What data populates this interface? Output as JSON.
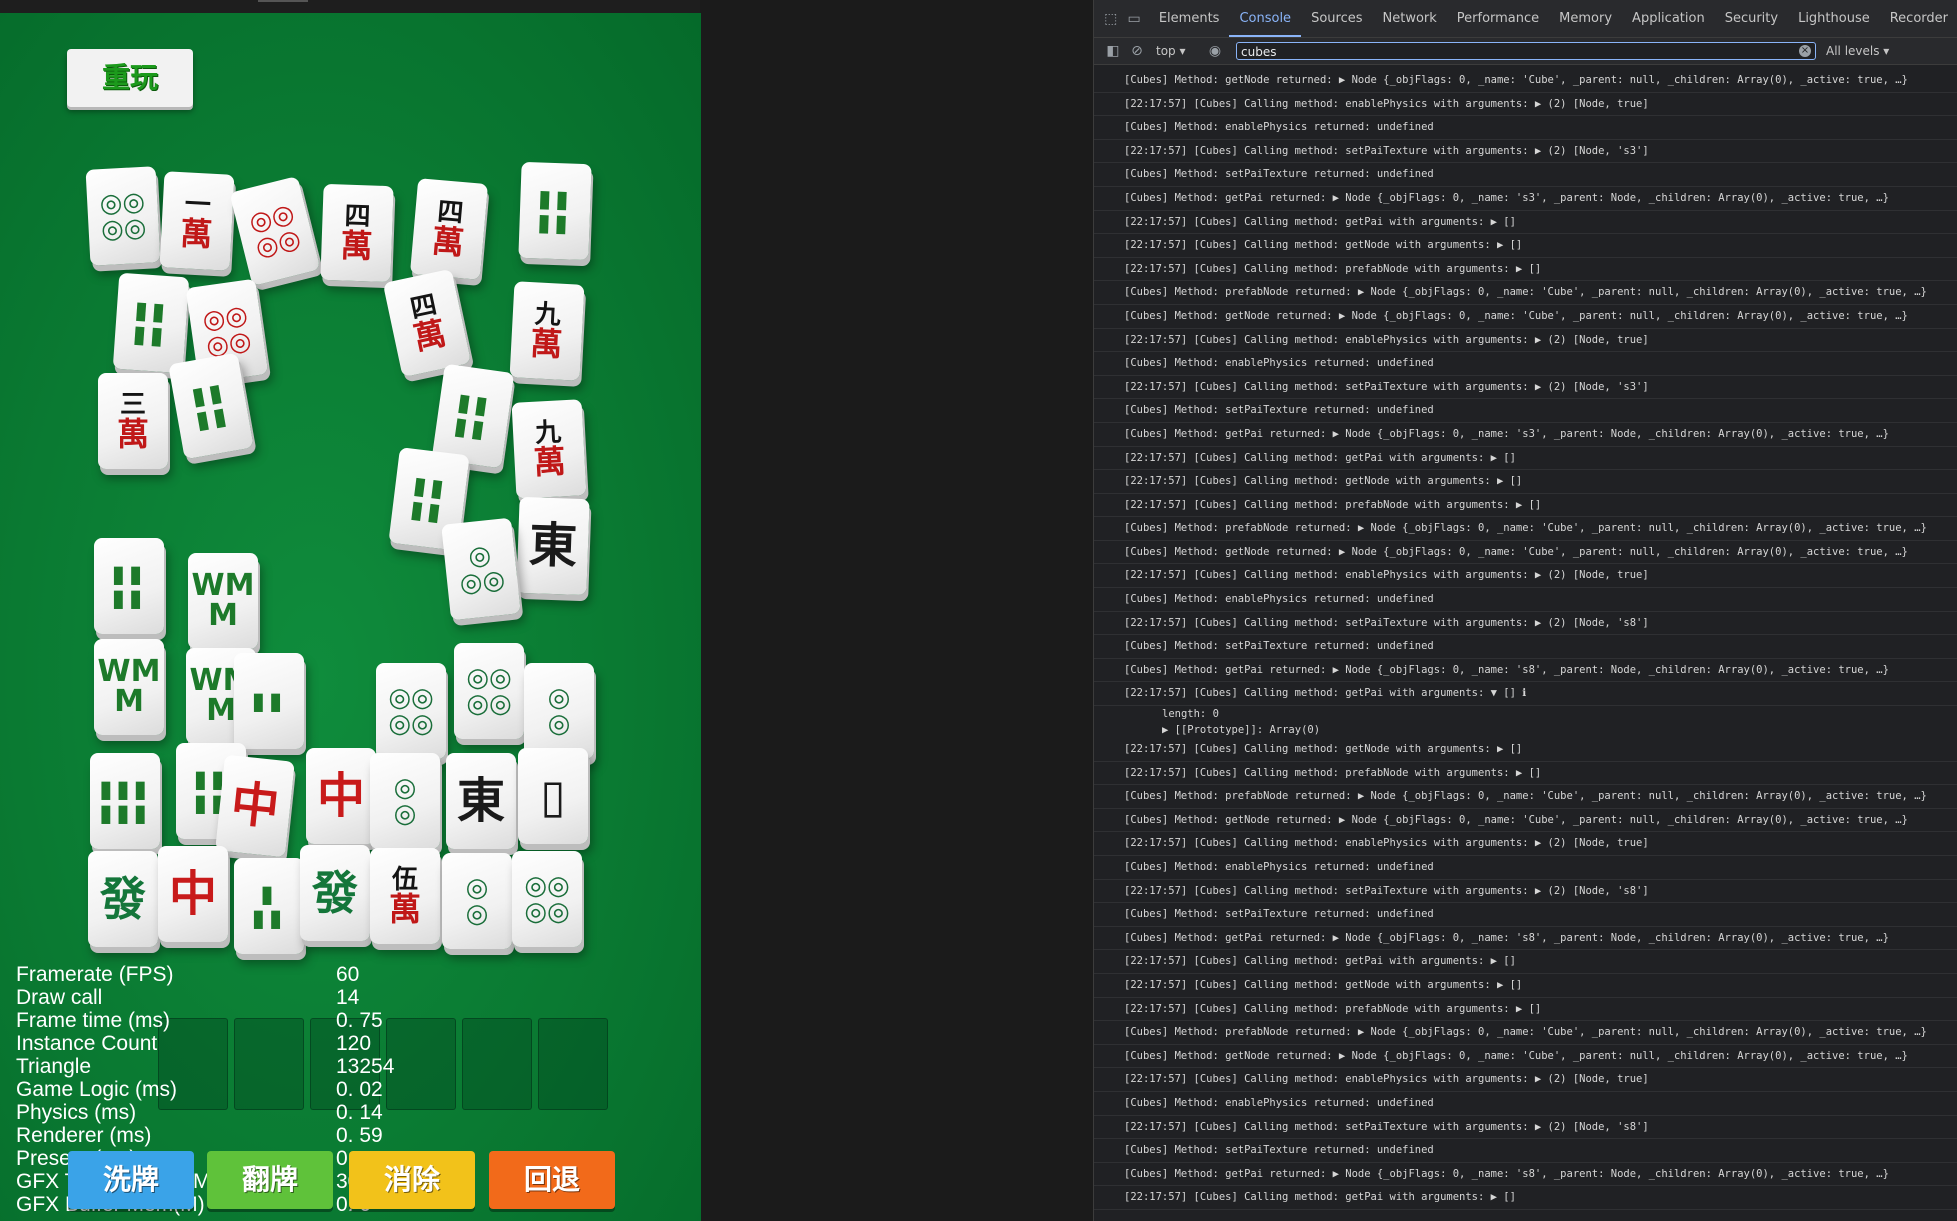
{
  "game": {
    "replay_label": "重玩",
    "stats": [
      {
        "label": "Framerate (FPS)",
        "value": "60"
      },
      {
        "label": "Draw call",
        "value": "14"
      },
      {
        "label": "Frame time (ms)",
        "value": "0. 75"
      },
      {
        "label": "Instance Count",
        "value": "120"
      },
      {
        "label": "Triangle",
        "value": "13254"
      },
      {
        "label": "Game Logic (ms)",
        "value": "0. 02"
      },
      {
        "label": "Physics (ms)",
        "value": "0. 14"
      },
      {
        "label": "Renderer (ms)",
        "value": "0. 59"
      },
      {
        "label": "Present (ms)",
        "value": "0"
      },
      {
        "label": "GFX Texture Mem(M)",
        "value": "30. 4"
      },
      {
        "label": "GFX Buffer Mem(M)",
        "value": "0. 0"
      }
    ],
    "buttons": {
      "shuffle": {
        "label": "洗牌",
        "color": "#3aa3e8"
      },
      "flip": {
        "label": "翻牌",
        "color": "#5fc23a"
      },
      "eliminate": {
        "label": "消除",
        "color": "#f2c21a"
      },
      "undo": {
        "label": "回退",
        "color": "#f26a1a"
      }
    }
  },
  "devtools": {
    "tabs": [
      "Elements",
      "Console",
      "Sources",
      "Network",
      "Performance",
      "Memory",
      "Application",
      "Security",
      "Lighthouse",
      "Recorder"
    ],
    "active_tab": "Console",
    "context": "top",
    "filter_value": "cubes",
    "levels": "All levels",
    "logs": [
      "[Cubes] Method: getNode returned: ▶ Node {_objFlags: 0, _name: 'Cube', _parent: null, _children: Array(0), _active: true, …}",
      "[22:17:57] [Cubes] Calling method: enablePhysics with arguments: ▶ (2) [Node, true]",
      "[Cubes] Method: enablePhysics returned: undefined",
      "[22:17:57] [Cubes] Calling method: setPaiTexture with arguments: ▶ (2) [Node, 's3']",
      "[Cubes] Method: setPaiTexture returned: undefined",
      "[Cubes] Method: getPai returned: ▶ Node {_objFlags: 0, _name: 's3', _parent: Node, _children: Array(0), _active: true, …}",
      "[22:17:57] [Cubes] Calling method: getPai with arguments: ▶ []",
      "[22:17:57] [Cubes] Calling method: getNode with arguments: ▶ []",
      "[22:17:57] [Cubes] Calling method: prefabNode with arguments: ▶ []",
      "[Cubes] Method: prefabNode returned: ▶ Node {_objFlags: 0, _name: 'Cube', _parent: null, _children: Array(0), _active: true, …}",
      "[Cubes] Method: getNode returned: ▶ Node {_objFlags: 0, _name: 'Cube', _parent: null, _children: Array(0), _active: true, …}",
      "[22:17:57] [Cubes] Calling method: enablePhysics with arguments: ▶ (2) [Node, true]",
      "[Cubes] Method: enablePhysics returned: undefined",
      "[22:17:57] [Cubes] Calling method: setPaiTexture with arguments: ▶ (2) [Node, 's3']",
      "[Cubes] Method: setPaiTexture returned: undefined",
      "[Cubes] Method: getPai returned: ▶ Node {_objFlags: 0, _name: 's3', _parent: Node, _children: Array(0), _active: true, …}",
      "[22:17:57] [Cubes] Calling method: getPai with arguments: ▶ []",
      "[22:17:57] [Cubes] Calling method: getNode with arguments: ▶ []",
      "[22:17:57] [Cubes] Calling method: prefabNode with arguments: ▶ []",
      "[Cubes] Method: prefabNode returned: ▶ Node {_objFlags: 0, _name: 'Cube', _parent: null, _children: Array(0), _active: true, …}",
      "[Cubes] Method: getNode returned: ▶ Node {_objFlags: 0, _name: 'Cube', _parent: null, _children: Array(0), _active: true, …}",
      "[22:17:57] [Cubes] Calling method: enablePhysics with arguments: ▶ (2) [Node, true]",
      "[Cubes] Method: enablePhysics returned: undefined",
      "[22:17:57] [Cubes] Calling method: setPaiTexture with arguments: ▶ (2) [Node, 's8']",
      "[Cubes] Method: setPaiTexture returned: undefined",
      "[Cubes] Method: getPai returned: ▶ Node {_objFlags: 0, _name: 's8', _parent: Node, _children: Array(0), _active: true, …}",
      "[22:17:57] [Cubes] Calling method: getPai with arguments: ▼ [] ℹ"
    ],
    "expanded": [
      "length: 0",
      "▶ [[Prototype]]: Array(0)"
    ],
    "logs2": [
      "[22:17:57] [Cubes] Calling method: getNode with arguments: ▶ []",
      "[22:17:57] [Cubes] Calling method: prefabNode with arguments: ▶ []",
      "[Cubes] Method: prefabNode returned: ▶ Node {_objFlags: 0, _name: 'Cube', _parent: null, _children: Array(0), _active: true, …}",
      "[Cubes] Method: getNode returned: ▶ Node {_objFlags: 0, _name: 'Cube', _parent: null, _children: Array(0), _active: true, …}",
      "[22:17:57] [Cubes] Calling method: enablePhysics with arguments: ▶ (2) [Node, true]",
      "[Cubes] Method: enablePhysics returned: undefined",
      "[22:17:57] [Cubes] Calling method: setPaiTexture with arguments: ▶ (2) [Node, 's8']",
      "[Cubes] Method: setPaiTexture returned: undefined",
      "[Cubes] Method: getPai returned: ▶ Node {_objFlags: 0, _name: 's8', _parent: Node, _children: Array(0), _active: true, …}",
      "[22:17:57] [Cubes] Calling method: getPai with arguments: ▶ []",
      "[22:17:57] [Cubes] Calling method: getNode with arguments: ▶ []",
      "[22:17:57] [Cubes] Calling method: prefabNode with arguments: ▶ []",
      "[Cubes] Method: prefabNode returned: ▶ Node {_objFlags: 0, _name: 'Cube', _parent: null, _children: Array(0), _active: true, …}",
      "[Cubes] Method: getNode returned: ▶ Node {_objFlags: 0, _name: 'Cube', _parent: null, _children: Array(0), _active: true, …}",
      "[22:17:57] [Cubes] Calling method: enablePhysics with arguments: ▶ (2) [Node, true]",
      "[Cubes] Method: enablePhysics returned: undefined",
      "[22:17:57] [Cubes] Calling method: setPaiTexture with arguments: ▶ (2) [Node, 's8']",
      "[Cubes] Method: setPaiTexture returned: undefined",
      "[Cubes] Method: getPai returned: ▶ Node {_objFlags: 0, _name: 's8', _parent: Node, _children: Array(0), _active: true, …}",
      "[22:17:57] [Cubes] Calling method: getPai with arguments: ▶ []"
    ]
  }
}
